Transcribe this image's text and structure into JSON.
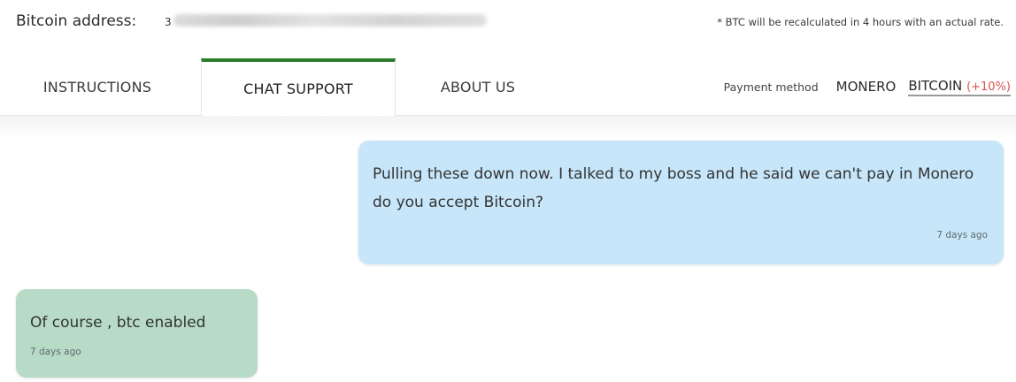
{
  "header": {
    "address_label": "Bitcoin address:",
    "address_value": "3",
    "rate_note": "* BTC will be recalculated in 4 hours with an actual rate."
  },
  "tabs": [
    {
      "label": "INSTRUCTIONS",
      "active": false
    },
    {
      "label": "CHAT SUPPORT",
      "active": true
    },
    {
      "label": "ABOUT US",
      "active": false
    }
  ],
  "payment": {
    "label": "Payment method",
    "options": [
      {
        "label": "MONERO",
        "selected": false
      },
      {
        "label": "BITCOIN",
        "bonus": "(+10%)",
        "selected": true
      }
    ]
  },
  "messages": [
    {
      "direction": "outgoing",
      "text": "Pulling these down now. I talked to my boss and he said we can't pay in Monero do you accept Bitcoin?",
      "time": "7 days ago"
    },
    {
      "direction": "incoming",
      "text": "Of course , btc enabled",
      "time": "7 days ago"
    }
  ],
  "colors": {
    "active_tab_accent": "#2e7d2e",
    "outgoing_bubble": "#c7e6f9",
    "incoming_bubble": "#b7dbc6",
    "bonus_text": "#d9534f"
  }
}
